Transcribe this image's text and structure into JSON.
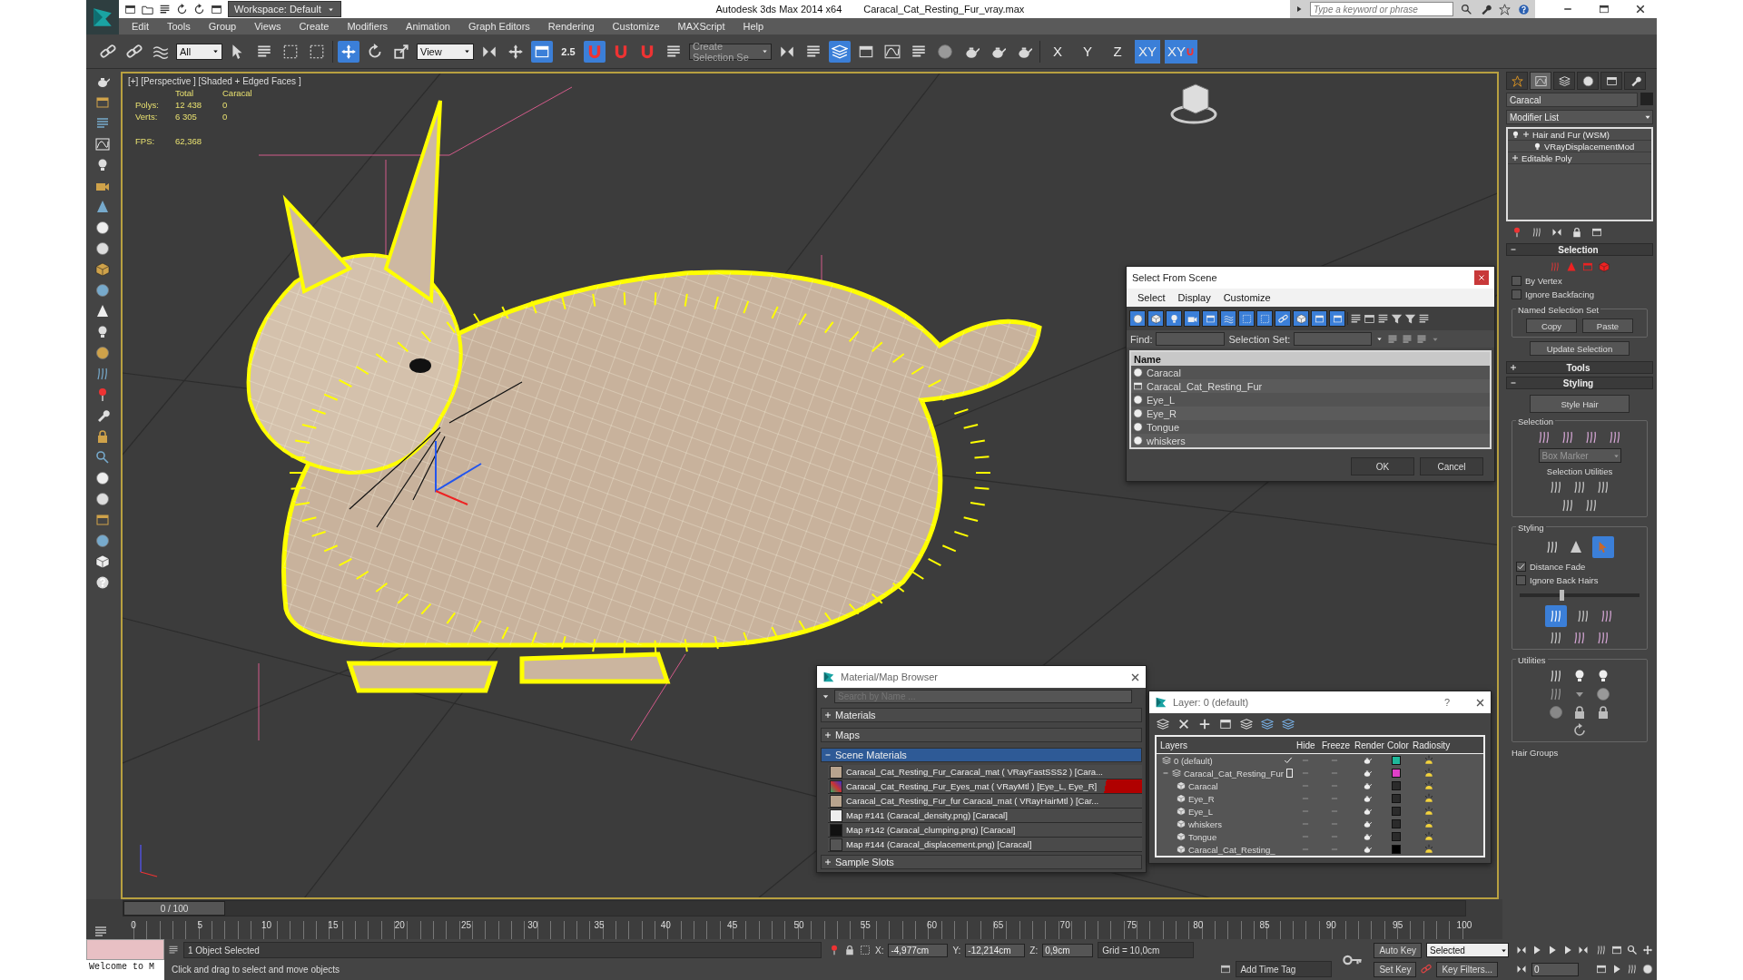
{
  "title_bar": {
    "workspace": "Workspace: Default",
    "app": "Autodesk 3ds Max  2014 x64",
    "file": "Caracal_Cat_Resting_Fur_vray.max",
    "search": {
      "placeholder": "Type a keyword or phrase"
    }
  },
  "menu": [
    "Edit",
    "Tools",
    "Group",
    "Views",
    "Create",
    "Modifiers",
    "Animation",
    "Graph Editors",
    "Rendering",
    "Customize",
    "MAXScript",
    "Help"
  ],
  "toolbar": {
    "filter": "All",
    "coord": "View",
    "snap": "2.5",
    "selection_set": {
      "placeholder": "Create Selection Se"
    },
    "axes": [
      {
        "label": "X",
        "selected": false,
        "kind": "plain"
      },
      {
        "label": "Y",
        "selected": false,
        "kind": "plain"
      },
      {
        "label": "Z",
        "selected": false,
        "kind": "plain"
      },
      {
        "label": "XY",
        "selected": true,
        "kind": "plain"
      },
      {
        "label": "XY",
        "selected": true,
        "kind": "snap"
      }
    ]
  },
  "viewport": {
    "label": "[+] [Perspective ] [Shaded + Edged Faces ]",
    "stats": {
      "columns": [
        "Total",
        "Caracal"
      ],
      "rows": [
        {
          "label": "Polys:",
          "values": [
            "12 438",
            "0"
          ]
        },
        {
          "label": "Verts:",
          "values": [
            "6 305",
            "0"
          ]
        }
      ],
      "fps_label": "FPS:",
      "fps": "62,368"
    }
  },
  "select_dialog": {
    "title": "Select From Scene",
    "menus": [
      "Select",
      "Display",
      "Customize"
    ],
    "find_label": "Find:",
    "selection_set_label": "Selection Set:",
    "column": "Name",
    "rows": [
      {
        "name": "Caracal",
        "kind": "geometry"
      },
      {
        "name": "Caracal_Cat_Resting_Fur",
        "kind": "group"
      },
      {
        "name": "Eye_L",
        "kind": "geometry"
      },
      {
        "name": "Eye_R",
        "kind": "geometry"
      },
      {
        "name": "Tongue",
        "kind": "geometry"
      },
      {
        "name": "whiskers",
        "kind": "geometry"
      }
    ],
    "buttons": [
      "OK",
      "Cancel"
    ]
  },
  "material_browser": {
    "title": "Material/Map Browser",
    "search": {
      "placeholder": "Search by Name ..."
    },
    "groups": [
      {
        "label": "Materials",
        "expanded": false
      },
      {
        "label": "Maps",
        "expanded": false
      },
      {
        "label": "Scene Materials",
        "expanded": true,
        "items": [
          {
            "name": "Caracal_Cat_Resting_Fur_Caracal_mat  ( VRayFastSSS2 ) [Cara...",
            "kind": "fur",
            "flagged": false
          },
          {
            "name": "Caracal_Cat_Resting_Fur_Eyes_mat  ( VRayMtl ) [Eye_L, Eye_R]",
            "kind": "eyes",
            "flagged": true
          },
          {
            "name": "Caracal_Cat_Resting_Fur_fur Caracal_mat  ( VRayHairMtl ) [Car...",
            "kind": "fur",
            "flagged": false
          },
          {
            "name": "Map #141 (Caracal_density.png)  [Caracal]",
            "kind": "map-light",
            "flagged": false
          },
          {
            "name": "Map #142 (Caracal_clumping.png)  [Caracal]",
            "kind": "map-dark",
            "flagged": false
          },
          {
            "name": "Map #144 (Caracal_displacement.png)  [Caracal]",
            "kind": "map-gray",
            "flagged": false
          }
        ]
      },
      {
        "label": "Sample Slots",
        "expanded": false
      }
    ]
  },
  "layer_dialog": {
    "title": "Layer: 0 (default)",
    "help": "?",
    "columns": [
      "Layers",
      "Hide",
      "Freeze",
      "Render",
      "Color",
      "Radiosity"
    ],
    "layers": [
      {
        "name": "0 (default)",
        "current": true,
        "color": "#1fb89a"
      },
      {
        "name": "Caracal_Cat_Resting_Fur",
        "current": false,
        "expanded": true,
        "color": "#e040c8",
        "children": [
          {
            "name": "Caracal",
            "color": "#2b2b2b"
          },
          {
            "name": "Eye_R",
            "color": "#2b2b2b"
          },
          {
            "name": "Eye_L",
            "color": "#2b2b2b"
          },
          {
            "name": "whiskers",
            "color": "#2b2b2b"
          },
          {
            "name": "Tongue",
            "color": "#2b2b2b"
          },
          {
            "name": "Caracal_Cat_Resting_",
            "color": "#000000"
          }
        ]
      }
    ]
  },
  "command_panel": {
    "tabs": [
      {
        "kind": "create",
        "selected": false
      },
      {
        "kind": "modify",
        "selected": true
      },
      {
        "kind": "hierarchy",
        "selected": false
      },
      {
        "kind": "motion",
        "selected": false
      },
      {
        "kind": "display",
        "selected": false
      },
      {
        "kind": "utilities",
        "selected": false
      }
    ],
    "object_name": "Caracal",
    "modifier_list": "Modifier List",
    "stack": [
      {
        "name": "Hair and Fur (WSM)",
        "kind": "modifier"
      },
      {
        "name": "VRayDisplacementMod",
        "kind": "sub"
      },
      {
        "name": "Editable Poly",
        "kind": "base"
      }
    ],
    "selection_rollout": {
      "title": "Selection",
      "expanded": true,
      "checks": [
        {
          "label": "By Vertex",
          "checked": false
        },
        {
          "label": "Ignore Backfacing",
          "checked": false
        }
      ],
      "named_set": "Named Selection Set",
      "buttons": [
        "Copy",
        "Paste"
      ],
      "update": "Update Selection"
    },
    "tools_rollout": {
      "title": "Tools",
      "expanded": false
    },
    "styling_rollout": {
      "title": "Styling",
      "expanded": true,
      "style_hair": "Style Hair",
      "selection_group": "Selection",
      "marker": "Box Marker",
      "utilities_label": "Selection Utilities",
      "styling_group": "Styling",
      "checks": [
        {
          "label": "Distance Fade",
          "checked": true
        },
        {
          "label": "Ignore Back Hairs",
          "checked": false
        }
      ],
      "slider": {
        "level": 0.35
      },
      "utilities_group": "Utilities",
      "hair_groups": "Hair Groups"
    }
  },
  "timeline": {
    "frame": "0 / 100",
    "level": 0,
    "ticks": [
      "0",
      "5",
      "10",
      "15",
      "20",
      "25",
      "30",
      "35",
      "40",
      "45",
      "50",
      "55",
      "60",
      "65",
      "70",
      "75",
      "80",
      "85",
      "90",
      "95",
      "100"
    ]
  },
  "status_bar": {
    "listener": "Welcome to M",
    "selected": "1 Object Selected",
    "prompt": "Click and drag to select and move objects",
    "coords": [
      {
        "axis": "X:",
        "value": "-4,977cm"
      },
      {
        "axis": "Y:",
        "value": "-12,214cm"
      },
      {
        "axis": "Z:",
        "value": "0,9cm"
      }
    ],
    "grid": "Grid = 10,0cm",
    "add_time_tag": "Add Time Tag",
    "auto_key": {
      "label": "Auto Key",
      "on": false
    },
    "key_mode": "Selected",
    "set_key": "Set Key",
    "key_filters": "Key Filters...",
    "current_frame": "0"
  }
}
